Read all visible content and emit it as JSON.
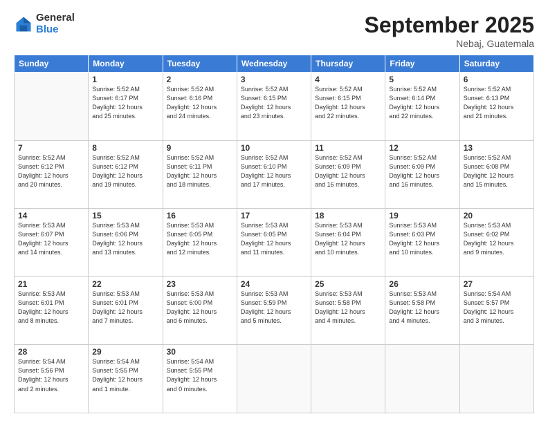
{
  "logo": {
    "general": "General",
    "blue": "Blue"
  },
  "header": {
    "month": "September 2025",
    "location": "Nebaj, Guatemala"
  },
  "days_of_week": [
    "Sunday",
    "Monday",
    "Tuesday",
    "Wednesday",
    "Thursday",
    "Friday",
    "Saturday"
  ],
  "weeks": [
    [
      {
        "day": "",
        "info": ""
      },
      {
        "day": "1",
        "info": "Sunrise: 5:52 AM\nSunset: 6:17 PM\nDaylight: 12 hours\nand 25 minutes."
      },
      {
        "day": "2",
        "info": "Sunrise: 5:52 AM\nSunset: 6:16 PM\nDaylight: 12 hours\nand 24 minutes."
      },
      {
        "day": "3",
        "info": "Sunrise: 5:52 AM\nSunset: 6:15 PM\nDaylight: 12 hours\nand 23 minutes."
      },
      {
        "day": "4",
        "info": "Sunrise: 5:52 AM\nSunset: 6:15 PM\nDaylight: 12 hours\nand 22 minutes."
      },
      {
        "day": "5",
        "info": "Sunrise: 5:52 AM\nSunset: 6:14 PM\nDaylight: 12 hours\nand 22 minutes."
      },
      {
        "day": "6",
        "info": "Sunrise: 5:52 AM\nSunset: 6:13 PM\nDaylight: 12 hours\nand 21 minutes."
      }
    ],
    [
      {
        "day": "7",
        "info": "Sunrise: 5:52 AM\nSunset: 6:12 PM\nDaylight: 12 hours\nand 20 minutes."
      },
      {
        "day": "8",
        "info": "Sunrise: 5:52 AM\nSunset: 6:12 PM\nDaylight: 12 hours\nand 19 minutes."
      },
      {
        "day": "9",
        "info": "Sunrise: 5:52 AM\nSunset: 6:11 PM\nDaylight: 12 hours\nand 18 minutes."
      },
      {
        "day": "10",
        "info": "Sunrise: 5:52 AM\nSunset: 6:10 PM\nDaylight: 12 hours\nand 17 minutes."
      },
      {
        "day": "11",
        "info": "Sunrise: 5:52 AM\nSunset: 6:09 PM\nDaylight: 12 hours\nand 16 minutes."
      },
      {
        "day": "12",
        "info": "Sunrise: 5:52 AM\nSunset: 6:09 PM\nDaylight: 12 hours\nand 16 minutes."
      },
      {
        "day": "13",
        "info": "Sunrise: 5:52 AM\nSunset: 6:08 PM\nDaylight: 12 hours\nand 15 minutes."
      }
    ],
    [
      {
        "day": "14",
        "info": "Sunrise: 5:53 AM\nSunset: 6:07 PM\nDaylight: 12 hours\nand 14 minutes."
      },
      {
        "day": "15",
        "info": "Sunrise: 5:53 AM\nSunset: 6:06 PM\nDaylight: 12 hours\nand 13 minutes."
      },
      {
        "day": "16",
        "info": "Sunrise: 5:53 AM\nSunset: 6:05 PM\nDaylight: 12 hours\nand 12 minutes."
      },
      {
        "day": "17",
        "info": "Sunrise: 5:53 AM\nSunset: 6:05 PM\nDaylight: 12 hours\nand 11 minutes."
      },
      {
        "day": "18",
        "info": "Sunrise: 5:53 AM\nSunset: 6:04 PM\nDaylight: 12 hours\nand 10 minutes."
      },
      {
        "day": "19",
        "info": "Sunrise: 5:53 AM\nSunset: 6:03 PM\nDaylight: 12 hours\nand 10 minutes."
      },
      {
        "day": "20",
        "info": "Sunrise: 5:53 AM\nSunset: 6:02 PM\nDaylight: 12 hours\nand 9 minutes."
      }
    ],
    [
      {
        "day": "21",
        "info": "Sunrise: 5:53 AM\nSunset: 6:01 PM\nDaylight: 12 hours\nand 8 minutes."
      },
      {
        "day": "22",
        "info": "Sunrise: 5:53 AM\nSunset: 6:01 PM\nDaylight: 12 hours\nand 7 minutes."
      },
      {
        "day": "23",
        "info": "Sunrise: 5:53 AM\nSunset: 6:00 PM\nDaylight: 12 hours\nand 6 minutes."
      },
      {
        "day": "24",
        "info": "Sunrise: 5:53 AM\nSunset: 5:59 PM\nDaylight: 12 hours\nand 5 minutes."
      },
      {
        "day": "25",
        "info": "Sunrise: 5:53 AM\nSunset: 5:58 PM\nDaylight: 12 hours\nand 4 minutes."
      },
      {
        "day": "26",
        "info": "Sunrise: 5:53 AM\nSunset: 5:58 PM\nDaylight: 12 hours\nand 4 minutes."
      },
      {
        "day": "27",
        "info": "Sunrise: 5:54 AM\nSunset: 5:57 PM\nDaylight: 12 hours\nand 3 minutes."
      }
    ],
    [
      {
        "day": "28",
        "info": "Sunrise: 5:54 AM\nSunset: 5:56 PM\nDaylight: 12 hours\nand 2 minutes."
      },
      {
        "day": "29",
        "info": "Sunrise: 5:54 AM\nSunset: 5:55 PM\nDaylight: 12 hours\nand 1 minute."
      },
      {
        "day": "30",
        "info": "Sunrise: 5:54 AM\nSunset: 5:55 PM\nDaylight: 12 hours\nand 0 minutes."
      },
      {
        "day": "",
        "info": ""
      },
      {
        "day": "",
        "info": ""
      },
      {
        "day": "",
        "info": ""
      },
      {
        "day": "",
        "info": ""
      }
    ]
  ]
}
